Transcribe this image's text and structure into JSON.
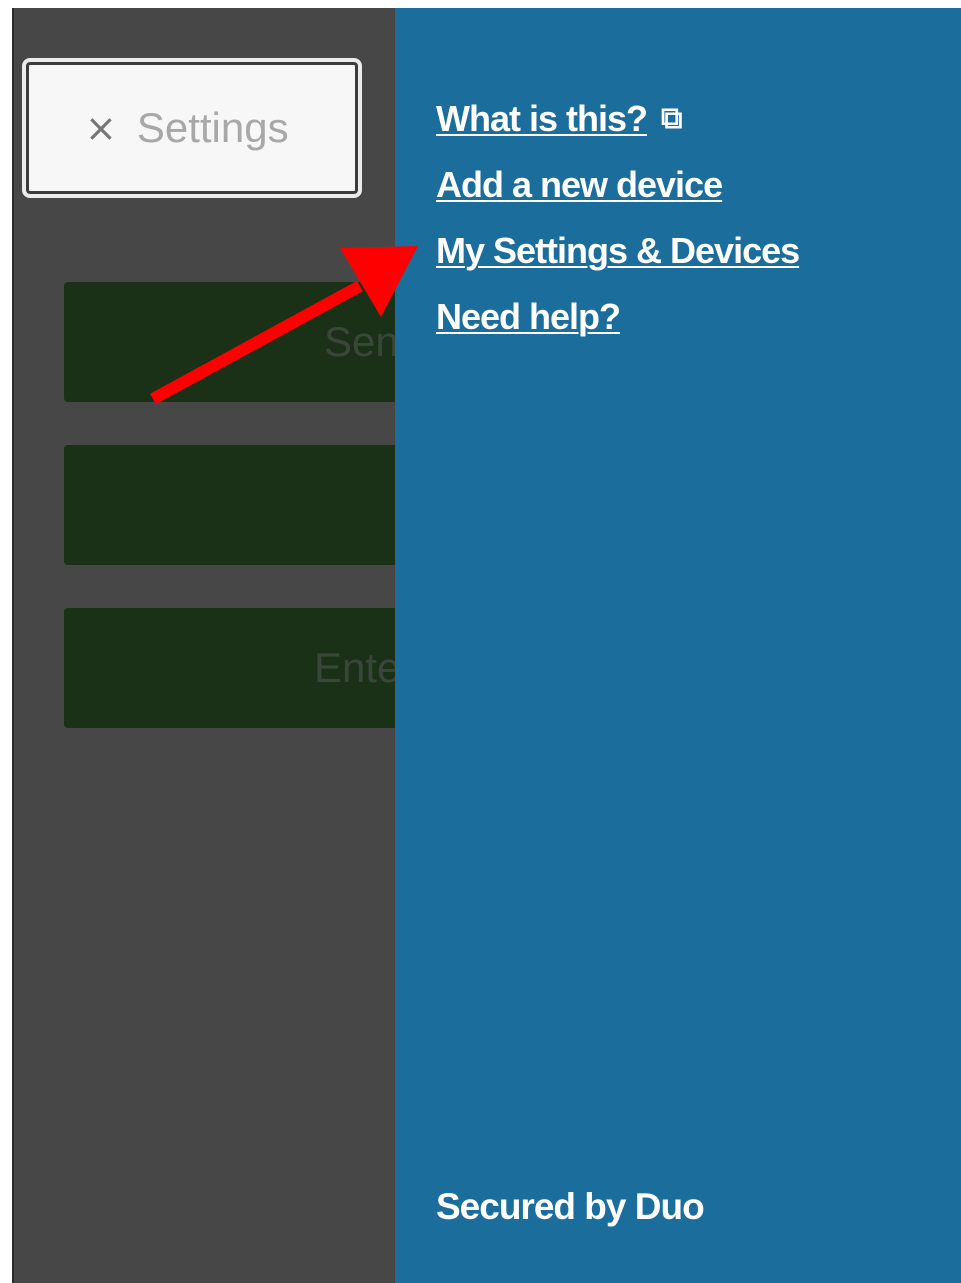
{
  "settings": {
    "close_icon": "×",
    "label": "Settings"
  },
  "methods": [
    {
      "label": "Sen"
    },
    {
      "label": ""
    },
    {
      "label": "Ente"
    }
  ],
  "menu": {
    "items": [
      {
        "label": "What is this?",
        "icon": "external-link-icon",
        "icon_glyph": "⧉"
      },
      {
        "label": "Add a new device"
      },
      {
        "label": "My Settings & Devices"
      },
      {
        "label": "Need help?"
      }
    ]
  },
  "footer": {
    "text": "Secured by Duo"
  },
  "colors": {
    "panel_blue": "#1b6d9c",
    "overlay_gray": "#474747",
    "button_green": "#1b3117",
    "arrow_red": "#ff0000"
  },
  "annotation": {
    "type": "arrow",
    "color": "#ff0000",
    "target": "My Settings & Devices"
  }
}
